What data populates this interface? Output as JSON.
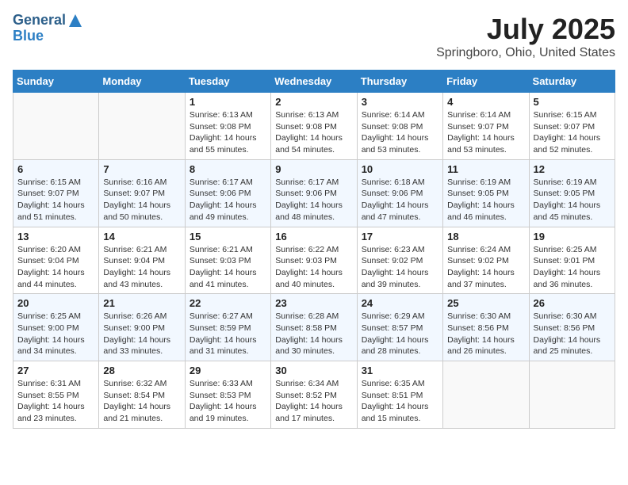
{
  "header": {
    "logo_line1": "General",
    "logo_line2": "Blue",
    "title": "July 2025",
    "subtitle": "Springboro, Ohio, United States"
  },
  "weekdays": [
    "Sunday",
    "Monday",
    "Tuesday",
    "Wednesday",
    "Thursday",
    "Friday",
    "Saturday"
  ],
  "weeks": [
    [
      {
        "day": "",
        "sunrise": "",
        "sunset": "",
        "daylight": ""
      },
      {
        "day": "",
        "sunrise": "",
        "sunset": "",
        "daylight": ""
      },
      {
        "day": "1",
        "sunrise": "Sunrise: 6:13 AM",
        "sunset": "Sunset: 9:08 PM",
        "daylight": "Daylight: 14 hours and 55 minutes."
      },
      {
        "day": "2",
        "sunrise": "Sunrise: 6:13 AM",
        "sunset": "Sunset: 9:08 PM",
        "daylight": "Daylight: 14 hours and 54 minutes."
      },
      {
        "day": "3",
        "sunrise": "Sunrise: 6:14 AM",
        "sunset": "Sunset: 9:08 PM",
        "daylight": "Daylight: 14 hours and 53 minutes."
      },
      {
        "day": "4",
        "sunrise": "Sunrise: 6:14 AM",
        "sunset": "Sunset: 9:07 PM",
        "daylight": "Daylight: 14 hours and 53 minutes."
      },
      {
        "day": "5",
        "sunrise": "Sunrise: 6:15 AM",
        "sunset": "Sunset: 9:07 PM",
        "daylight": "Daylight: 14 hours and 52 minutes."
      }
    ],
    [
      {
        "day": "6",
        "sunrise": "Sunrise: 6:15 AM",
        "sunset": "Sunset: 9:07 PM",
        "daylight": "Daylight: 14 hours and 51 minutes."
      },
      {
        "day": "7",
        "sunrise": "Sunrise: 6:16 AM",
        "sunset": "Sunset: 9:07 PM",
        "daylight": "Daylight: 14 hours and 50 minutes."
      },
      {
        "day": "8",
        "sunrise": "Sunrise: 6:17 AM",
        "sunset": "Sunset: 9:06 PM",
        "daylight": "Daylight: 14 hours and 49 minutes."
      },
      {
        "day": "9",
        "sunrise": "Sunrise: 6:17 AM",
        "sunset": "Sunset: 9:06 PM",
        "daylight": "Daylight: 14 hours and 48 minutes."
      },
      {
        "day": "10",
        "sunrise": "Sunrise: 6:18 AM",
        "sunset": "Sunset: 9:06 PM",
        "daylight": "Daylight: 14 hours and 47 minutes."
      },
      {
        "day": "11",
        "sunrise": "Sunrise: 6:19 AM",
        "sunset": "Sunset: 9:05 PM",
        "daylight": "Daylight: 14 hours and 46 minutes."
      },
      {
        "day": "12",
        "sunrise": "Sunrise: 6:19 AM",
        "sunset": "Sunset: 9:05 PM",
        "daylight": "Daylight: 14 hours and 45 minutes."
      }
    ],
    [
      {
        "day": "13",
        "sunrise": "Sunrise: 6:20 AM",
        "sunset": "Sunset: 9:04 PM",
        "daylight": "Daylight: 14 hours and 44 minutes."
      },
      {
        "day": "14",
        "sunrise": "Sunrise: 6:21 AM",
        "sunset": "Sunset: 9:04 PM",
        "daylight": "Daylight: 14 hours and 43 minutes."
      },
      {
        "day": "15",
        "sunrise": "Sunrise: 6:21 AM",
        "sunset": "Sunset: 9:03 PM",
        "daylight": "Daylight: 14 hours and 41 minutes."
      },
      {
        "day": "16",
        "sunrise": "Sunrise: 6:22 AM",
        "sunset": "Sunset: 9:03 PM",
        "daylight": "Daylight: 14 hours and 40 minutes."
      },
      {
        "day": "17",
        "sunrise": "Sunrise: 6:23 AM",
        "sunset": "Sunset: 9:02 PM",
        "daylight": "Daylight: 14 hours and 39 minutes."
      },
      {
        "day": "18",
        "sunrise": "Sunrise: 6:24 AM",
        "sunset": "Sunset: 9:02 PM",
        "daylight": "Daylight: 14 hours and 37 minutes."
      },
      {
        "day": "19",
        "sunrise": "Sunrise: 6:25 AM",
        "sunset": "Sunset: 9:01 PM",
        "daylight": "Daylight: 14 hours and 36 minutes."
      }
    ],
    [
      {
        "day": "20",
        "sunrise": "Sunrise: 6:25 AM",
        "sunset": "Sunset: 9:00 PM",
        "daylight": "Daylight: 14 hours and 34 minutes."
      },
      {
        "day": "21",
        "sunrise": "Sunrise: 6:26 AM",
        "sunset": "Sunset: 9:00 PM",
        "daylight": "Daylight: 14 hours and 33 minutes."
      },
      {
        "day": "22",
        "sunrise": "Sunrise: 6:27 AM",
        "sunset": "Sunset: 8:59 PM",
        "daylight": "Daylight: 14 hours and 31 minutes."
      },
      {
        "day": "23",
        "sunrise": "Sunrise: 6:28 AM",
        "sunset": "Sunset: 8:58 PM",
        "daylight": "Daylight: 14 hours and 30 minutes."
      },
      {
        "day": "24",
        "sunrise": "Sunrise: 6:29 AM",
        "sunset": "Sunset: 8:57 PM",
        "daylight": "Daylight: 14 hours and 28 minutes."
      },
      {
        "day": "25",
        "sunrise": "Sunrise: 6:30 AM",
        "sunset": "Sunset: 8:56 PM",
        "daylight": "Daylight: 14 hours and 26 minutes."
      },
      {
        "day": "26",
        "sunrise": "Sunrise: 6:30 AM",
        "sunset": "Sunset: 8:56 PM",
        "daylight": "Daylight: 14 hours and 25 minutes."
      }
    ],
    [
      {
        "day": "27",
        "sunrise": "Sunrise: 6:31 AM",
        "sunset": "Sunset: 8:55 PM",
        "daylight": "Daylight: 14 hours and 23 minutes."
      },
      {
        "day": "28",
        "sunrise": "Sunrise: 6:32 AM",
        "sunset": "Sunset: 8:54 PM",
        "daylight": "Daylight: 14 hours and 21 minutes."
      },
      {
        "day": "29",
        "sunrise": "Sunrise: 6:33 AM",
        "sunset": "Sunset: 8:53 PM",
        "daylight": "Daylight: 14 hours and 19 minutes."
      },
      {
        "day": "30",
        "sunrise": "Sunrise: 6:34 AM",
        "sunset": "Sunset: 8:52 PM",
        "daylight": "Daylight: 14 hours and 17 minutes."
      },
      {
        "day": "31",
        "sunrise": "Sunrise: 6:35 AM",
        "sunset": "Sunset: 8:51 PM",
        "daylight": "Daylight: 14 hours and 15 minutes."
      },
      {
        "day": "",
        "sunrise": "",
        "sunset": "",
        "daylight": ""
      },
      {
        "day": "",
        "sunrise": "",
        "sunset": "",
        "daylight": ""
      }
    ]
  ]
}
